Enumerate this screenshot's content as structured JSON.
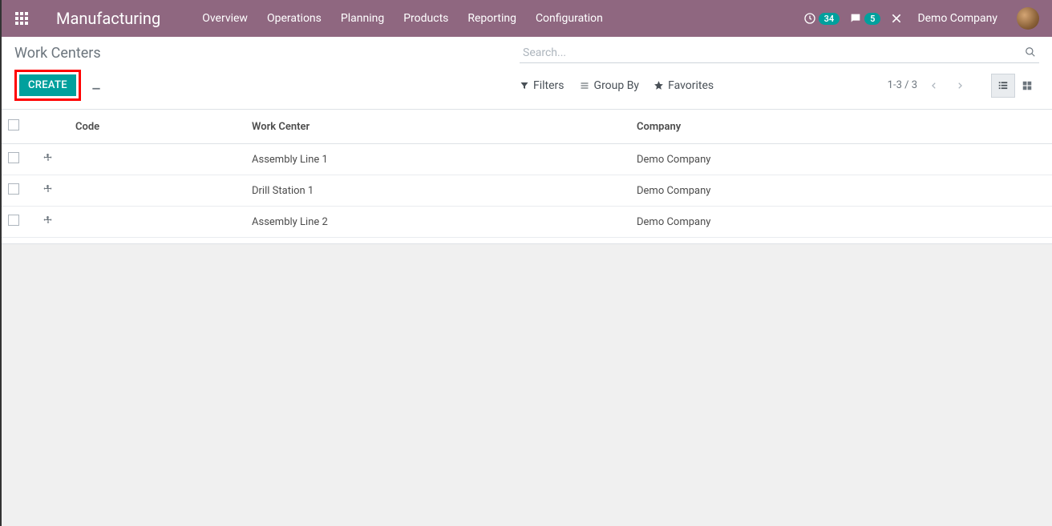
{
  "navbar": {
    "brand": "Manufacturing",
    "menu": [
      "Overview",
      "Operations",
      "Planning",
      "Products",
      "Reporting",
      "Configuration"
    ],
    "activity_count": "34",
    "discuss_count": "5",
    "company": "Demo Company"
  },
  "control": {
    "breadcrumb": "Work Centers",
    "create_label": "CREATE",
    "search_placeholder": "Search...",
    "filters_label": "Filters",
    "groupby_label": "Group By",
    "favorites_label": "Favorites",
    "pager": "1-3 / 3"
  },
  "table": {
    "headers": {
      "code": "Code",
      "work_center": "Work Center",
      "company": "Company"
    },
    "rows": [
      {
        "code": "",
        "work_center": "Assembly Line 1",
        "company": "Demo Company"
      },
      {
        "code": "",
        "work_center": "Drill Station 1",
        "company": "Demo Company"
      },
      {
        "code": "",
        "work_center": "Assembly Line 2",
        "company": "Demo Company"
      }
    ]
  }
}
